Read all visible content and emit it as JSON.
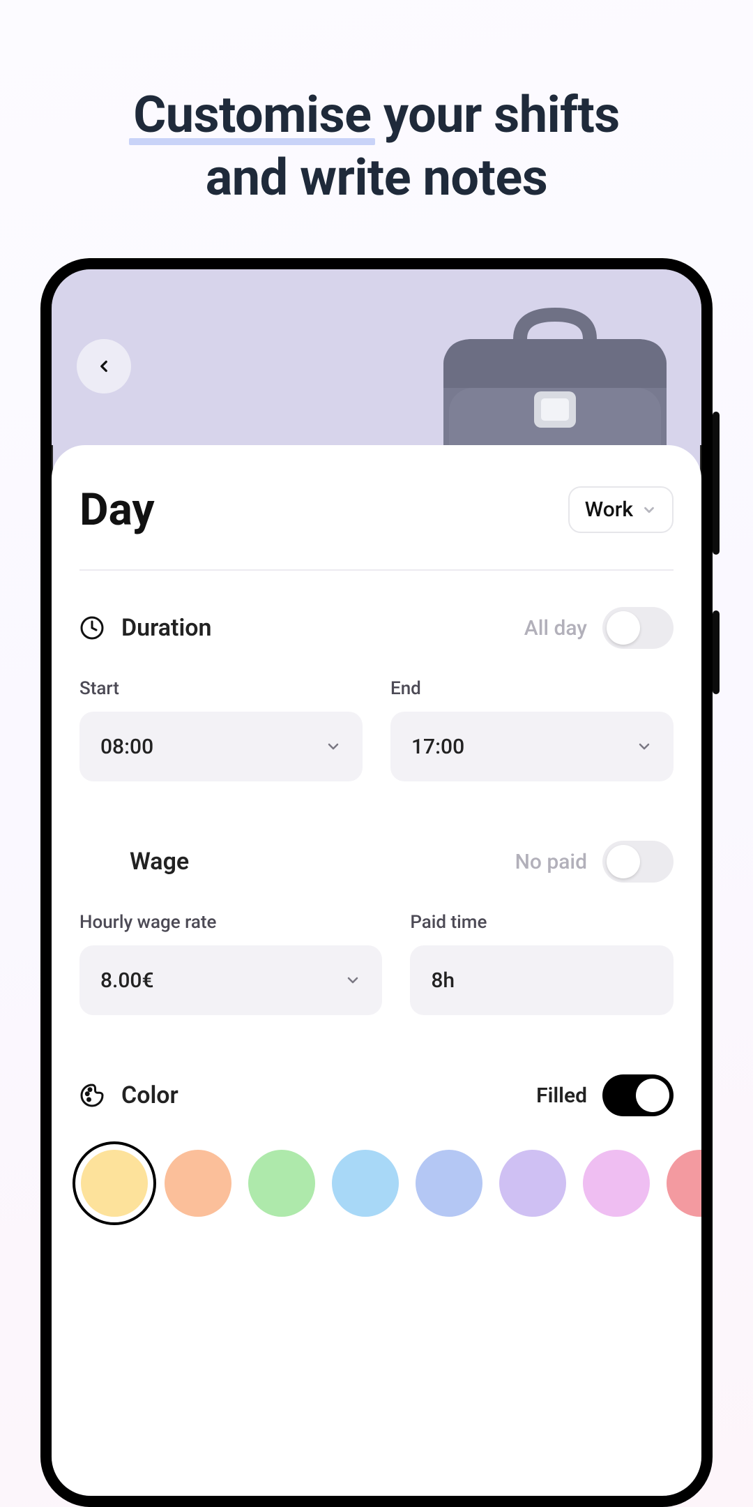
{
  "promo": {
    "highlight_word": "Customise",
    "title_rest_line1": " your shifts",
    "title_line2": "and write notes"
  },
  "header": {
    "title": "Day",
    "type_selected": "Work"
  },
  "duration": {
    "icon": "clock",
    "label": "Duration",
    "all_day_label": "All day",
    "all_day_on": false,
    "start_label": "Start",
    "start_value": "08:00",
    "end_label": "End",
    "end_value": "17:00"
  },
  "wage": {
    "label": "Wage",
    "no_paid_label": "No paid",
    "no_paid_on": false,
    "rate_label": "Hourly wage rate",
    "rate_value": "8.00€",
    "paid_time_label": "Paid time",
    "paid_time_value": "8h"
  },
  "color": {
    "icon": "palette",
    "label": "Color",
    "filled_label": "Filled",
    "filled_on": true,
    "swatches": [
      "#fde29b",
      "#fbbf9a",
      "#aee9ab",
      "#a8d8f7",
      "#b4c7f4",
      "#cfc0f3",
      "#efbef2",
      "#f39aa0"
    ],
    "selected_index": 0
  }
}
